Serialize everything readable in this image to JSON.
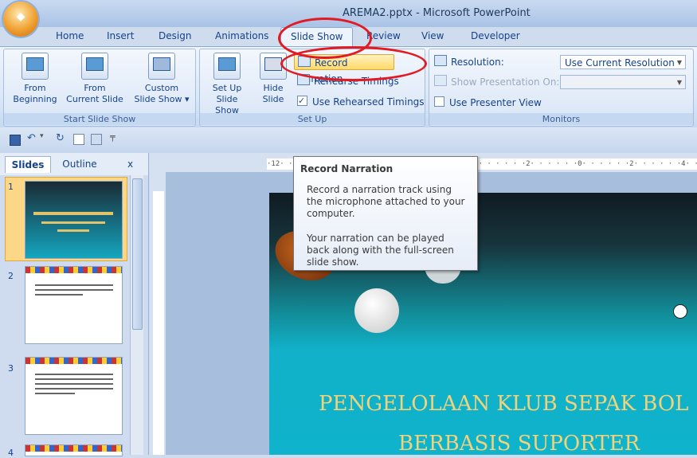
{
  "window": {
    "title": "AREMA2.pptx - Microsoft PowerPoint"
  },
  "tabs": [
    {
      "label": "Home"
    },
    {
      "label": "Insert"
    },
    {
      "label": "Design"
    },
    {
      "label": "Animations"
    },
    {
      "label": "Slide Show",
      "active": true
    },
    {
      "label": "Review"
    },
    {
      "label": "View"
    },
    {
      "label": "Developer"
    }
  ],
  "ribbon": {
    "start_group": {
      "label": "Start Slide Show",
      "from_beginning": {
        "line1": "From",
        "line2": "Beginning"
      },
      "from_current": {
        "line1": "From",
        "line2": "Current Slide"
      },
      "custom": {
        "line1": "Custom",
        "line2": "Slide Show ▾"
      }
    },
    "setup_group": {
      "label": "Set Up",
      "setup_slideshow": {
        "line1": "Set Up",
        "line2": "Slide Show"
      },
      "hide_slide": {
        "line1": "Hide",
        "line2": "Slide"
      },
      "record_narration": "Record Narration",
      "rehearse_timings": "Rehearse Timings",
      "use_rehearsed": "Use Rehearsed Timings"
    },
    "monitors_group": {
      "label": "Monitors",
      "resolution_label": "Resolution:",
      "resolution_value": "Use Current Resolution",
      "show_on_label": "Show Presentation On:",
      "presenter_view": "Use Presenter View"
    }
  },
  "pane": {
    "slides_tab": "Slides",
    "outline_tab": "Outline",
    "close": "x",
    "thumbnails": [
      "1",
      "2",
      "3",
      "4"
    ]
  },
  "ruler": {
    "text": "·12· ·  ·  ·  ·  ·  ·  ·  ·  ·  ·  ·  ·  ·  ·  ·  ·  ·  ·  ·  ·  ·  ·  ·  ·  ·  ·  ·  ·2·  ·  ·  ·  ·  ·0·  ·  ·  ·  ·  ·2·  ·  ·  ·  ·  ·4·  ·  ·  ·  ·  ·6·  ·  ·  ·  ·  ·8·"
  },
  "tooltip": {
    "title": "Record Narration",
    "body1": "Record a narration track using the microphone attached to your computer.",
    "body2": "Your narration can be played back along with the full-screen slide show."
  },
  "slide": {
    "title_line1": "PENGELOLAAN KLUB SEPAK BOL",
    "title_line2": "BERBASIS SUPORTER"
  },
  "colors": {
    "annotation": "#e21a22",
    "ribbon": "#dce8f7",
    "title_text": "#f2d27a"
  }
}
